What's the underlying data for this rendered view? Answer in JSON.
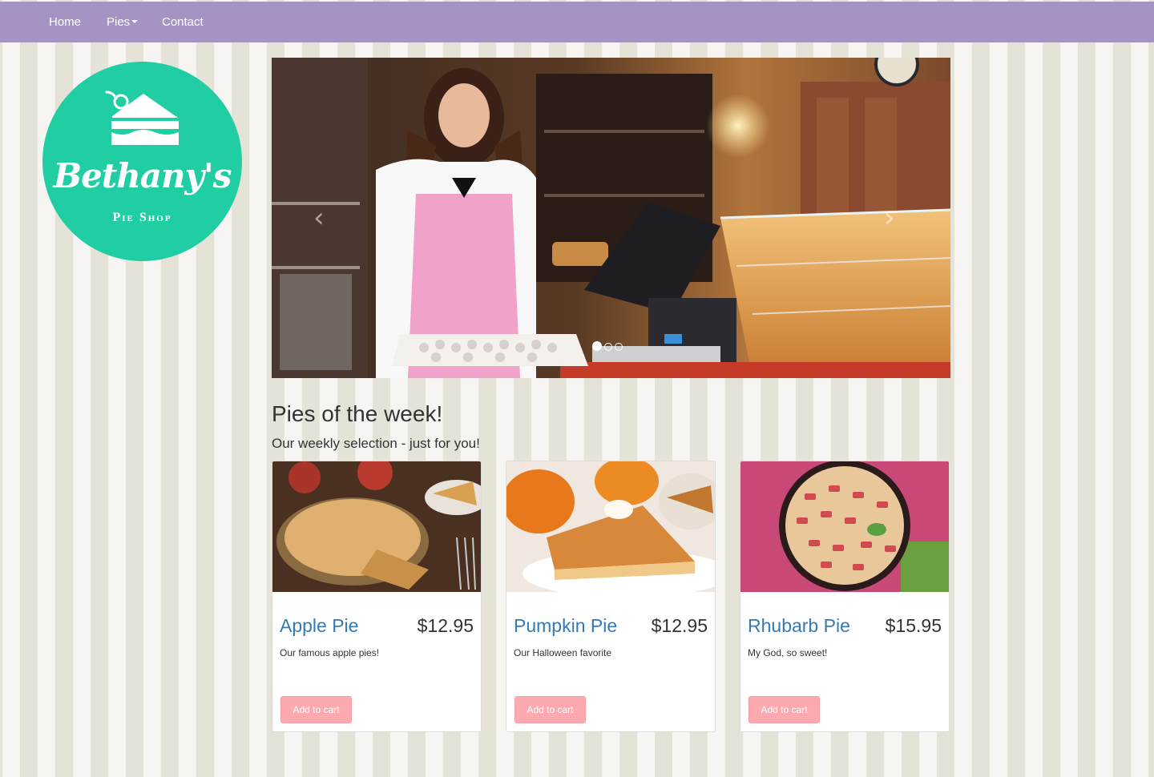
{
  "nav": {
    "home": "Home",
    "pies": "Pies",
    "contact": "Contact"
  },
  "logo": {
    "name": "Bethany's",
    "subtitle": "Pie Shop"
  },
  "carousel": {
    "slide_count": 3,
    "active_index": 0,
    "prev_label": "‹",
    "next_label": "›"
  },
  "section": {
    "title": "Pies of the week!",
    "subtitle": "Our weekly selection - just for you!"
  },
  "pies": [
    {
      "name": "Apple Pie",
      "price": "$12.95",
      "description": "Our famous apple pies!",
      "button": "Add to cart"
    },
    {
      "name": "Pumpkin Pie",
      "price": "$12.95",
      "description": "Our Halloween favorite",
      "button": "Add to cart"
    },
    {
      "name": "Rhubarb Pie",
      "price": "$15.95",
      "description": "My God, so sweet!",
      "button": "Add to cart"
    }
  ],
  "colors": {
    "navbar": "#a593c4",
    "logo": "#21cea4",
    "link": "#337ab7",
    "button": "#fcaaaf"
  }
}
